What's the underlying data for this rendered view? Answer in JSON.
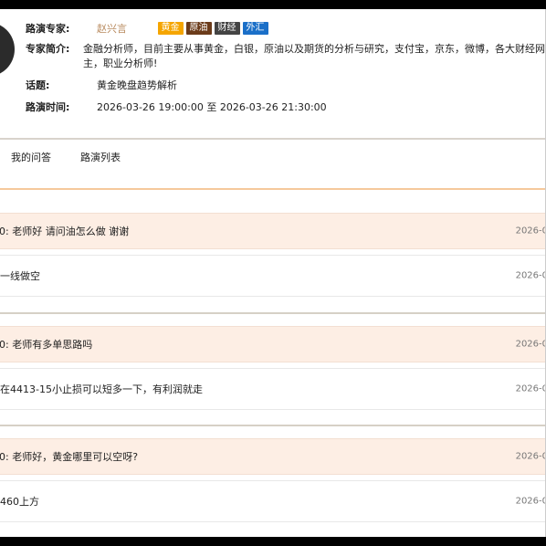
{
  "expert": {
    "label": "路演专家:",
    "name": "赵兴言",
    "tags": [
      "黄金",
      "原油",
      "财经",
      "外汇"
    ],
    "intro_label": "专家简介:",
    "intro_line1": "金融分析师，目前主要从事黄金，白银，原油以及期货的分析与研究，支付宝，京东，微博，各大财经网",
    "intro_line2": "主，职业分析师!",
    "topic_label": "话题:",
    "topic": "黄金晚盘趋势解析",
    "time_label": "路演时间:",
    "time": "2026-03-26 19:00:00 至 2026-03-26 21:30:00"
  },
  "tabs": [
    "我的问答",
    "路演列表"
  ],
  "threads": [
    {
      "question": "0:  老师好 请问油怎么做 谢谢",
      "q_time": "2026-0",
      "answer": "一线做空",
      "a_time": "2026-0"
    },
    {
      "question": "0:  老师有多单思路吗",
      "q_time": "2026-0",
      "answer": "在4413-15小止损可以短多一下，有利润就走",
      "a_time": "2026-0"
    },
    {
      "question": "0:  老师好，黄金哪里可以空呀?",
      "q_time": "2026-0",
      "answer": "460上方",
      "a_time": "2026-0"
    }
  ],
  "colors": {
    "question_bg": "#fdeee4",
    "tag_gold": "#f5a500",
    "tag_oil": "#6b3b1a",
    "tag_fin": "#444444",
    "tag_fx": "#1a6fc8",
    "expert_name": "#b88a5e"
  }
}
